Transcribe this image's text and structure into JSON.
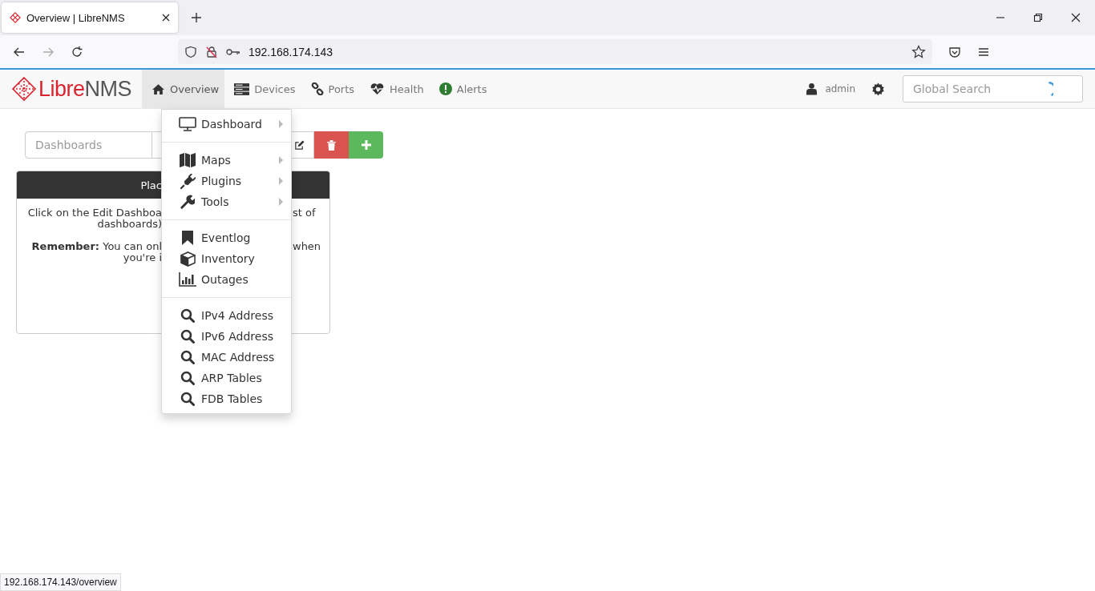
{
  "browser": {
    "tab_title": "Overview | LibreNMS",
    "url": "192.168.174.143"
  },
  "navbar": {
    "brand_parts": [
      "Libre",
      "NMS"
    ],
    "items": [
      {
        "label": "Overview",
        "selected": true
      },
      {
        "label": "Devices",
        "selected": false
      },
      {
        "label": "Ports",
        "selected": false
      },
      {
        "label": "Health",
        "selected": false
      },
      {
        "label": "Alerts",
        "selected": false
      }
    ],
    "user": "admin",
    "search": {
      "placeholder": "Global Search"
    }
  },
  "toolbar": {
    "dashboard_placeholder": "Dashboards"
  },
  "panel": {
    "heading": "Plac",
    "lines": [
      {
        "left": "Click on the Edit Dashboa",
        "right": "st of"
      },
      {
        "left": "dashboards)"
      },
      {
        "left": "**Remember:** You can onl",
        "right": "when"
      },
      {
        "left": "you're i"
      }
    ]
  },
  "menu": {
    "sections": [
      [
        {
          "label": "Dashboard",
          "submenu": true
        }
      ],
      [
        {
          "label": "Maps",
          "submenu": true
        },
        {
          "label": "Plugins",
          "submenu": true
        },
        {
          "label": "Tools",
          "submenu": true
        }
      ],
      [
        {
          "label": "Eventlog",
          "submenu": false
        },
        {
          "label": "Inventory",
          "submenu": false
        },
        {
          "label": "Outages",
          "submenu": false
        }
      ],
      [
        {
          "label": "IPv4 Address",
          "submenu": false
        },
        {
          "label": "IPv6 Address",
          "submenu": false
        },
        {
          "label": "MAC Address",
          "submenu": false
        },
        {
          "label": "ARP Tables",
          "submenu": false
        },
        {
          "label": "FDB Tables",
          "submenu": false
        }
      ]
    ]
  },
  "status_bar": "192.168.174.143/overview"
}
